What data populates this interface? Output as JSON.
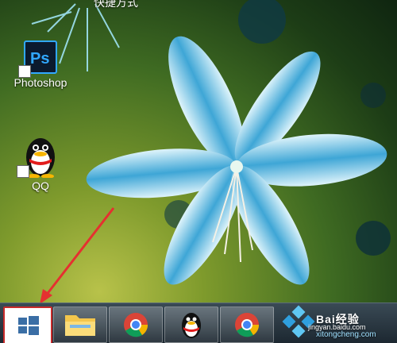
{
  "desktop": {
    "top_caption": "快捷方式",
    "icons": [
      {
        "label": "Photoshop",
        "icon": "photoshop-icon"
      },
      {
        "label": "QQ",
        "icon": "qq-penguin-icon"
      }
    ]
  },
  "taskbar": {
    "buttons": [
      {
        "name": "start",
        "icon": "windows-logo-icon"
      },
      {
        "name": "file-explorer",
        "icon": "folder-icon"
      },
      {
        "name": "chrome",
        "icon": "chrome-icon"
      },
      {
        "name": "qq",
        "icon": "qq-penguin-icon"
      },
      {
        "name": "chrome-2",
        "icon": "chrome-icon"
      }
    ]
  },
  "watermarks": {
    "baidu": "jingyan.baidu.com",
    "site": "xitongcheng.com"
  },
  "annotation": {
    "color": "#e53030"
  }
}
